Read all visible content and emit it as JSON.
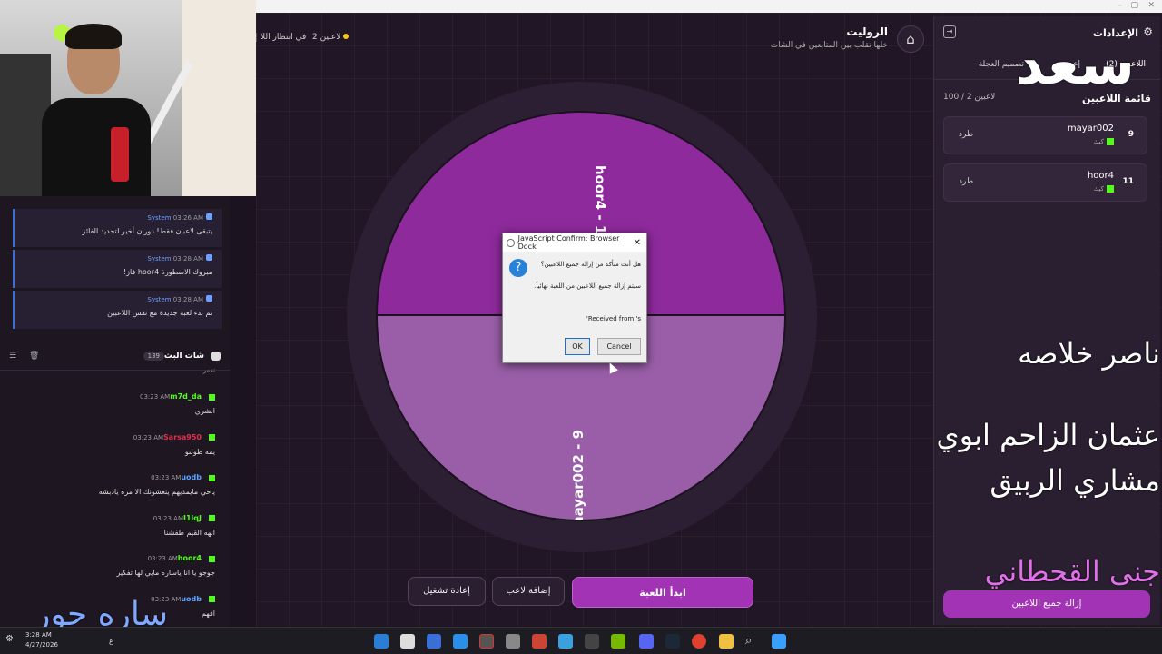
{
  "header": {
    "title": "الروليت",
    "subtitle": "خلها تقلب بين المتابعين في الشات",
    "players_count": "2 لاعبين",
    "waiting": "في انتظار اللا"
  },
  "wheel": {
    "segments": [
      {
        "label": "hoor4 - 11",
        "color": "#8e2a9c"
      },
      {
        "label": "mayar002 - 9",
        "color": "#9a5ea8"
      }
    ]
  },
  "dialog": {
    "title": "JavaScript Confirm: Browser Dock",
    "line1": "هل أنت متأكد من إزالة جميع اللاعبين؟",
    "line2": "سيتم إزالة جميع اللاعبين من اللعبة نهائياً.",
    "line3": "'Received from 's",
    "ok": "OK",
    "cancel": "Cancel"
  },
  "actions": {
    "start": "ابدأ اللعبة",
    "add_player": "إضافة لاعب",
    "restart": "إعادة تشغيل"
  },
  "settings_panel": {
    "title": "الإعدادات",
    "tabs": [
      "اللاعبين (2)",
      "إعد",
      "تصميم العجلة"
    ],
    "list_title": "قائمة اللاعبين",
    "list_count": "100 / 2 لاعبين",
    "players": [
      {
        "num": "9",
        "name": "mayar002",
        "source": "كيك",
        "action": "طرد"
      },
      {
        "num": "11",
        "name": "hoor4",
        "source": "كيك",
        "action": "طرد"
      }
    ],
    "remove_all": "إزالة جميع اللاعبين"
  },
  "overlay": {
    "big": "سعد",
    "names": [
      "ناصر خلاصه",
      "عثمان الزاحم ابوي",
      "مشاري الربيق",
      "جنى القحطاني"
    ],
    "bottom_left": "ساره حور"
  },
  "system_feed": [
    {
      "user": "System",
      "time": "03:26 AM",
      "text": "يتبقى لاعبان فقط! دوران أخير لتحديد الفائز"
    },
    {
      "user": "System",
      "time": "03:28 AM",
      "text": "مبروك الاسطورة hoor4 فاز!"
    },
    {
      "user": "System",
      "time": "03:28 AM",
      "text": "تم بدء لعبة جديدة مع نفس اللاعبين"
    }
  ],
  "chat": {
    "title": "شات البث",
    "count": "139",
    "partial_text": "تقمر",
    "messages": [
      {
        "user": "m7d_da",
        "color": "#53fc18",
        "time": "03:23 AM",
        "text": "ابشري"
      },
      {
        "user": "Sarsa950",
        "color": "#e0304a",
        "time": "03:23 AM",
        "text": "يمه طولتو"
      },
      {
        "user": "uodb",
        "color": "#5aa0ff",
        "time": "03:23 AM",
        "text": "ياخي مايمديهم ينعشونك الا مره يادبشه"
      },
      {
        "user": "I1lqJ",
        "color": "#53fc18",
        "time": "03:23 AM",
        "text": "انهه القيم طفشنا"
      },
      {
        "user": "hoor4",
        "color": "#53fc18",
        "time": "03:23 AM",
        "text": "جوجو يا انا ياساره مايي لها تفكير"
      },
      {
        "user": "uodb",
        "color": "#5aa0ff",
        "time": "03:23 AM",
        "text": "افهم"
      }
    ]
  },
  "taskbar": {
    "time": "3:28 AM",
    "date": "4/27/2026",
    "lang": "ع"
  }
}
